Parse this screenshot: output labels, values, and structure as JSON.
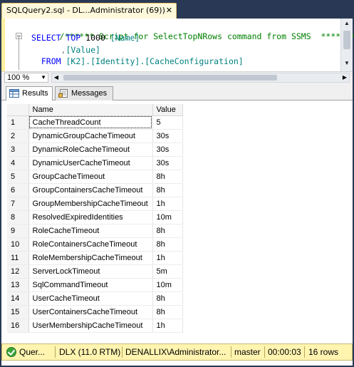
{
  "document_tab": {
    "title": "SQLQuery2.sql - DL...Administrator (69))",
    "close_glyph": "✕"
  },
  "editor": {
    "line1": "/****** Script for SelectTopNRows command from SSMS  ******/",
    "line2_kw1": "SELECT TOP",
    "line2_num": " 1000 ",
    "line2_col": "[Name]",
    "line3_comma": "      ,",
    "line3_col": "[Value]",
    "line4_kw": "  FROM ",
    "line4_obj": "[K2].[Identity].[CacheConfiguration]"
  },
  "zoom": {
    "value": "100 %"
  },
  "results_tabs": [
    {
      "label": "Results"
    },
    {
      "label": "Messages"
    }
  ],
  "grid": {
    "columns": [
      "Name",
      "Value"
    ],
    "rows": [
      {
        "n": "1",
        "name": "CacheThreadCount",
        "value": "5"
      },
      {
        "n": "2",
        "name": "DynamicGroupCacheTimeout",
        "value": "30s"
      },
      {
        "n": "3",
        "name": "DynamicRoleCacheTimeout",
        "value": "30s"
      },
      {
        "n": "4",
        "name": "DynamicUserCacheTimeout",
        "value": "30s"
      },
      {
        "n": "5",
        "name": "GroupCacheTimeout",
        "value": "8h"
      },
      {
        "n": "6",
        "name": "GroupContainersCacheTimeout",
        "value": "8h"
      },
      {
        "n": "7",
        "name": "GroupMembershipCacheTimeout",
        "value": "1h"
      },
      {
        "n": "8",
        "name": "ResolvedExpiredIdentities",
        "value": "10m"
      },
      {
        "n": "9",
        "name": "RoleCacheTimeout",
        "value": "8h"
      },
      {
        "n": "10",
        "name": "RoleContainersCacheTimeout",
        "value": "8h"
      },
      {
        "n": "11",
        "name": "RoleMembershipCacheTimeout",
        "value": "1h"
      },
      {
        "n": "12",
        "name": "ServerLockTimeout",
        "value": "5m"
      },
      {
        "n": "13",
        "name": "SqlCommandTimeout",
        "value": "10m"
      },
      {
        "n": "14",
        "name": "UserCacheTimeout",
        "value": "8h"
      },
      {
        "n": "15",
        "name": "UserContainersCacheTimeout",
        "value": "8h"
      },
      {
        "n": "16",
        "name": "UserMembershipCacheTimeout",
        "value": "1h"
      }
    ]
  },
  "status": {
    "query": "Quer...",
    "server": "DLX (11.0 RTM)",
    "user": "DENALLIX\\Administrator...",
    "database": "master",
    "elapsed": "00:00:03",
    "rows": "16 rows"
  },
  "colors": {
    "frame": "#293955",
    "tab_active": "#fff9dc",
    "status_bar": "#fff4b0",
    "comment": "#008000",
    "keyword": "#0000ff",
    "identifier": "#008080"
  }
}
